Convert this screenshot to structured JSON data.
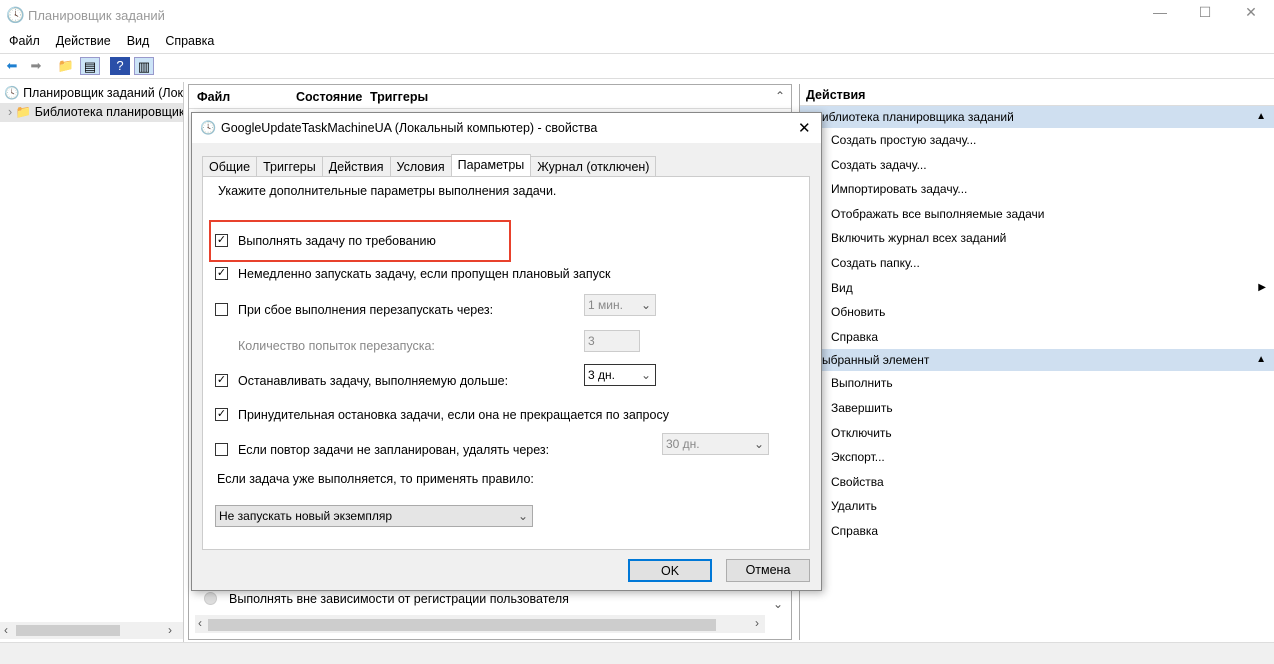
{
  "window": {
    "title": "Планировщик заданий"
  },
  "menu": [
    "Файл",
    "Действие",
    "Вид",
    "Справка"
  ],
  "tree": {
    "root": "Планировщик заданий (Локальный)",
    "library": "Библиотека планировщика заданий"
  },
  "table": {
    "columns": [
      "Файл",
      "Состояние",
      "Триггеры"
    ]
  },
  "behind": {
    "option": "Выполнять вне зависимости от регистрации пользователя"
  },
  "actions": {
    "header": "Действия",
    "section1": "Библиотека планировщика заданий",
    "items1": [
      "Создать простую задачу...",
      "Создать задачу...",
      "Импортировать задачу...",
      "Отображать все выполняемые задачи",
      "Включить журнал всех заданий",
      "Создать папку...",
      "Вид",
      "Обновить",
      "Справка"
    ],
    "section2": "Выбранный элемент",
    "items2": [
      "Выполнить",
      "Завершить",
      "Отключить",
      "Экспорт...",
      "Свойства",
      "Удалить",
      "Справка"
    ]
  },
  "dialog": {
    "title": "GoogleUpdateTaskMachineUA (Локальный компьютер) - свойства",
    "tabs": [
      "Общие",
      "Триггеры",
      "Действия",
      "Условия",
      "Параметры",
      "Журнал (отключен)"
    ],
    "intro": "Укажите дополнительные параметры выполнения задачи.",
    "opt1": "Выполнять задачу по требованию",
    "opt2": "Немедленно запускать задачу, если пропущен плановый запуск",
    "opt3": "При сбое выполнения перезапускать через:",
    "opt3_value": "1 мин.",
    "retry_label": "Количество попыток перезапуска:",
    "retry_value": "3",
    "opt4": "Останавливать задачу, выполняемую дольше:",
    "opt4_value": "3 дн.",
    "opt5": "Принудительная остановка задачи, если она не прекращается по запросу",
    "opt6": "Если повтор задачи не запланирован, удалять через:",
    "opt6_value": "30 дн.",
    "rule_label": "Если задача уже выполняется, то применять правило:",
    "rule_value": "Не запускать новый экземпляр",
    "ok": "OK",
    "cancel": "Отмена",
    "check": "✓"
  },
  "colors": {
    "highlight": "#e8412c",
    "accent": "#0078d7"
  }
}
